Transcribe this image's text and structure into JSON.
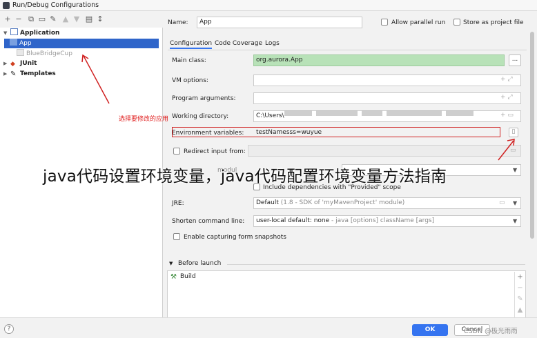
{
  "window": {
    "title": "Run/Debug Configurations"
  },
  "toolbar": {
    "icons": [
      "add-icon",
      "remove-icon",
      "copy-icon",
      "save-icon",
      "wrench-icon",
      "move-up-icon",
      "move-down-icon",
      "folder-icon",
      "sort-icon"
    ]
  },
  "tree": {
    "application": "Application",
    "app": "App",
    "bluebridgecup": "BlueBridgeCup",
    "junit": "JUnit",
    "templates": "Templates"
  },
  "header": {
    "name_label": "Name:",
    "name_value": "App",
    "parallel_label": "Allow parallel run",
    "store_label": "Store as project file"
  },
  "tabs": [
    "Configuration",
    "Code Coverage",
    "Logs"
  ],
  "form": {
    "main_class_label": "Main class:",
    "main_class_value": "org.aurora.App",
    "browse_label": "...",
    "vm_label": "VM options:",
    "program_args_label": "Program arguments:",
    "working_dir_label": "Working directory:",
    "working_dir_value": "C:\\Users\\",
    "env_label": "Environment variables:",
    "env_value": "testNamesss=wuyue",
    "redirect_label": "Redirect input from:",
    "use_classpath_fragment": "modul",
    "include_deps_label": "Include dependencies with \"Provided\" scope",
    "jre_label": "JRE:",
    "jre_value": "Default",
    "jre_hint": "(1.8 - SDK of 'myMavenProject' module)",
    "shorten_label": "Shorten command line:",
    "shorten_value": "user-local default: none",
    "shorten_hint": "- java [options] className [args]",
    "snapshots_label": "Enable capturing form snapshots"
  },
  "before_launch": {
    "label": "Before launch",
    "build_label": "Build"
  },
  "buttons": {
    "ok": "OK",
    "cancel": "Cancel",
    "help": "?"
  },
  "annotation": {
    "text": "选择要修改的应用"
  },
  "overlay": {
    "title": "java代码设置环境变量，java代码配置环境变量方法指南"
  },
  "watermark": {
    "text": "CSDN @极光雨雨"
  },
  "colors": {
    "accent": "#3574f0",
    "selection": "#2f65ca",
    "annotation": "#d02020",
    "main_class_bg": "#b8e2b8"
  }
}
